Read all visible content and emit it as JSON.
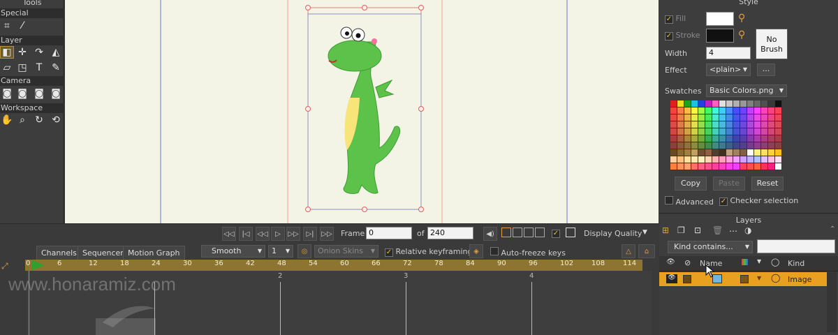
{
  "tools": {
    "title": "Tools",
    "sections": {
      "special": "Special",
      "layer": "Layer",
      "camera": "Camera",
      "workspace": "Workspace"
    }
  },
  "style": {
    "title": "Style",
    "fill_label": "Fill",
    "stroke_label": "Stroke",
    "no_brush": [
      "No",
      "Brush"
    ],
    "width_label": "Width",
    "width_value": "4",
    "effect_label": "Effect",
    "effect_value": "<plain>",
    "effect_more": "...",
    "swatches_label": "Swatches",
    "swatches_value": "Basic Colors.png",
    "copy": "Copy",
    "paste": "Paste",
    "reset": "Reset",
    "advanced": "Advanced",
    "checker": "Checker selection"
  },
  "playback": {
    "frame_label": "Frame",
    "frame_value": "0",
    "of_label": "of",
    "total_frames": "240",
    "display_quality": "Display Quality"
  },
  "timeline": {
    "tabs": [
      "Channels",
      "Sequencer",
      "Motion Graph"
    ],
    "interp": "Smooth",
    "interp_count": "1",
    "onion_skins": "Onion Skins",
    "relative_keyframing": "Relative keyframing",
    "auto_freeze": "Auto-freeze keys",
    "ruler_ticks": [
      "0",
      "6",
      "12",
      "18",
      "24",
      "30",
      "36",
      "42",
      "48",
      "54",
      "60",
      "66",
      "72",
      "78",
      "84",
      "90",
      "96",
      "102",
      "108",
      "114"
    ],
    "second_markers": [
      "2",
      "3",
      "4"
    ],
    "watermark": "www.honaramiz.com"
  },
  "layers": {
    "title": "Layers",
    "filter": "Kind contains...",
    "col_name": "Name",
    "col_kind": "Kind",
    "row_kind": "Image"
  },
  "colors": {
    "accent": "#f0a020",
    "ruler": "#8d7430",
    "canvas_bg": "#f3f3e6",
    "dragon": "#5cc24a",
    "selected_row": "#e8a020"
  }
}
